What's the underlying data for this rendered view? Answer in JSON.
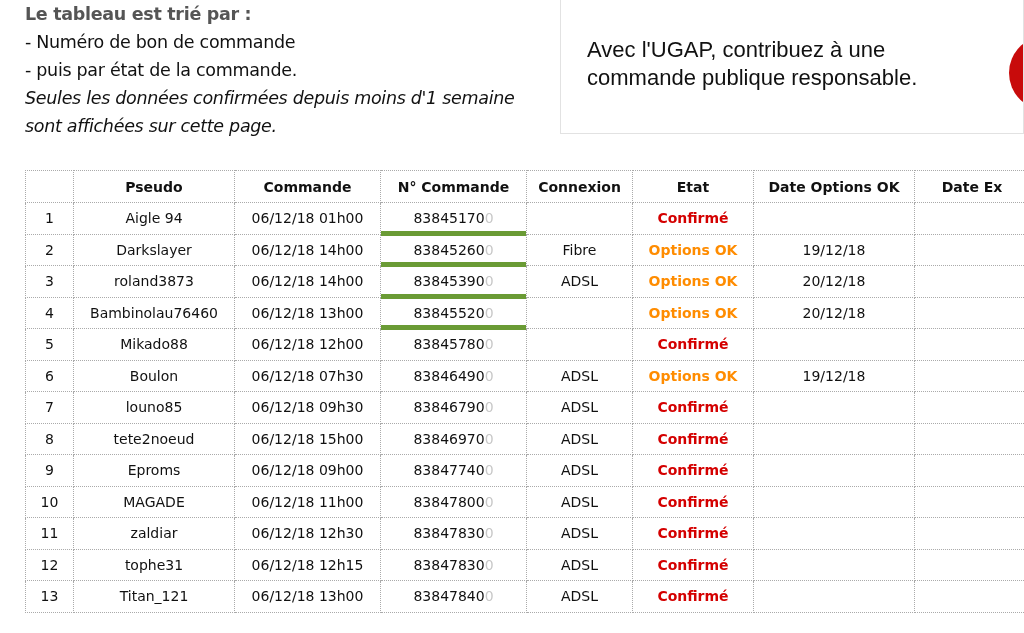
{
  "intro": {
    "heading": "Le tableau est trié par :",
    "lines": [
      "- Numéro de bon de commande",
      "- puis par état de la commande."
    ],
    "note": "Seules les données confirmées depuis moins d'1 semaine sont affichées sur cette page."
  },
  "banner": {
    "text": "Avec l'UGAP, contribuez à une commande publique responsable."
  },
  "table": {
    "columns": [
      "Pseudo",
      "Commande",
      "N° Commande",
      "Connexion",
      "Etat",
      "Date Options OK",
      "Date Ex"
    ],
    "rows": [
      {
        "index": "1",
        "pseudo": "Aigle 94",
        "date": "06/12/18 01h00",
        "number": "83845170",
        "suffix": "0",
        "highlighted": true,
        "connexion": "",
        "etat": "Confirmé",
        "kind": "confirmed",
        "options_date": ""
      },
      {
        "index": "2",
        "pseudo": "Darkslayer",
        "date": "06/12/18 14h00",
        "number": "83845260",
        "suffix": "0",
        "highlighted": true,
        "connexion": "Fibre",
        "etat": "Options OK",
        "kind": "options",
        "options_date": "19/12/18"
      },
      {
        "index": "3",
        "pseudo": "roland3873",
        "date": "06/12/18 14h00",
        "number": "83845390",
        "suffix": "0",
        "highlighted": true,
        "connexion": "ADSL",
        "etat": "Options OK",
        "kind": "options",
        "options_date": "20/12/18"
      },
      {
        "index": "4",
        "pseudo": "Bambinolau76460",
        "date": "06/12/18 13h00",
        "number": "83845520",
        "suffix": "0",
        "highlighted": true,
        "connexion": "",
        "etat": "Options OK",
        "kind": "options",
        "options_date": "20/12/18"
      },
      {
        "index": "5",
        "pseudo": "Mikado88",
        "date": "06/12/18 12h00",
        "number": "83845780",
        "suffix": "0",
        "highlighted": false,
        "connexion": "",
        "etat": "Confirmé",
        "kind": "confirmed",
        "options_date": ""
      },
      {
        "index": "6",
        "pseudo": "Boulon",
        "date": "06/12/18 07h30",
        "number": "83846490",
        "suffix": "0",
        "highlighted": false,
        "connexion": "ADSL",
        "etat": "Options OK",
        "kind": "options",
        "options_date": "19/12/18"
      },
      {
        "index": "7",
        "pseudo": "louno85",
        "date": "06/12/18 09h30",
        "number": "83846790",
        "suffix": "0",
        "highlighted": false,
        "connexion": "ADSL",
        "etat": "Confirmé",
        "kind": "confirmed",
        "options_date": ""
      },
      {
        "index": "8",
        "pseudo": "tete2noeud",
        "date": "06/12/18 15h00",
        "number": "83846970",
        "suffix": "0",
        "highlighted": false,
        "connexion": "ADSL",
        "etat": "Confirmé",
        "kind": "confirmed",
        "options_date": ""
      },
      {
        "index": "9",
        "pseudo": "Eproms",
        "date": "06/12/18 09h00",
        "number": "83847740",
        "suffix": "0",
        "highlighted": false,
        "connexion": "ADSL",
        "etat": "Confirmé",
        "kind": "confirmed",
        "options_date": ""
      },
      {
        "index": "10",
        "pseudo": "MAGADE",
        "date": "06/12/18 11h00",
        "number": "83847800",
        "suffix": "0",
        "highlighted": false,
        "connexion": "ADSL",
        "etat": "Confirmé",
        "kind": "confirmed",
        "options_date": ""
      },
      {
        "index": "11",
        "pseudo": "zaldiar",
        "date": "06/12/18 12h30",
        "number": "83847830",
        "suffix": "0",
        "highlighted": false,
        "connexion": "ADSL",
        "etat": "Confirmé",
        "kind": "confirmed",
        "options_date": ""
      },
      {
        "index": "12",
        "pseudo": "tophe31",
        "date": "06/12/18 12h15",
        "number": "83847830",
        "suffix": "0",
        "highlighted": false,
        "connexion": "ADSL",
        "etat": "Confirmé",
        "kind": "confirmed",
        "options_date": ""
      },
      {
        "index": "13",
        "pseudo": "Titan_121",
        "date": "06/12/18 13h00",
        "number": "83847840",
        "suffix": "0",
        "highlighted": false,
        "connexion": "ADSL",
        "etat": "Confirmé",
        "kind": "confirmed",
        "options_date": ""
      }
    ]
  }
}
